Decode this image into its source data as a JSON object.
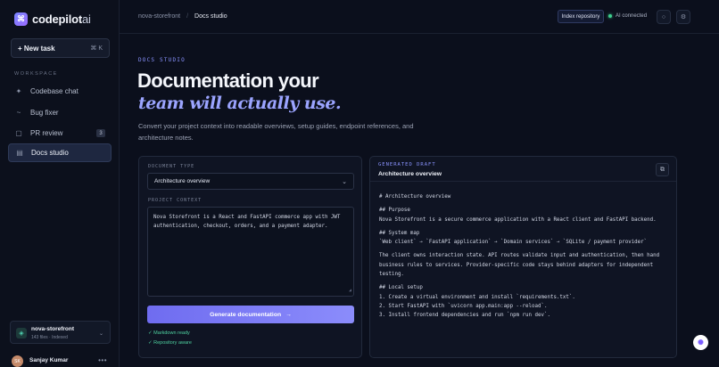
{
  "brand": {
    "name": "codepilot",
    "suffix": "ai",
    "logo_icon": "command-icon"
  },
  "sidebar": {
    "new_task_label": "+ New task",
    "new_task_shortcut": "⌘ K",
    "section": "WORKSPACE",
    "items": [
      {
        "label": "Codebase chat",
        "icon": "sparkle-icon",
        "badge": ""
      },
      {
        "label": "Bug fixer",
        "icon": "wave-icon",
        "badge": ""
      },
      {
        "label": "PR review",
        "icon": "square-icon",
        "badge": "3"
      },
      {
        "label": "Docs studio",
        "icon": "doc-icon",
        "badge": "",
        "active": true
      }
    ],
    "repo": {
      "name": "nova-storefront",
      "meta": "143 files · Indexed"
    },
    "user": {
      "name": "Sanjay Kumar",
      "initials": "SK"
    }
  },
  "topbar": {
    "breadcrumb": [
      "nova-storefront",
      "Docs studio"
    ],
    "index_button": "Index repository",
    "ai_status": "AI connected",
    "status_color": "#3ecf8e"
  },
  "hero": {
    "kicker": "DOCS STUDIO",
    "title_line1": "Documentation your",
    "title_line2": "team will actually use.",
    "description": "Convert your project context into readable overviews, setup guides, endpoint references, and architecture notes."
  },
  "form": {
    "doc_type_label": "DOCUMENT TYPE",
    "doc_type_value": "Architecture overview",
    "context_label": "PROJECT CONTEXT",
    "context_value": "Nova Storefront is a React and FastAPI commerce app with JWT authentication, checkout, orders, and a payment adapter.",
    "generate_label": "Generate documentation",
    "generate_arrow": "→",
    "checks": [
      "✓ Markdown ready",
      "✓ Repository aware"
    ]
  },
  "draft": {
    "kicker": "GENERATED DRAFT",
    "title": "Architecture overview",
    "lines": [
      "# Architecture overview",
      "",
      "## Purpose",
      "Nova Storefront is a secure commerce application with a React client and FastAPI backend.",
      "",
      "## System map",
      "`Web client` → `FastAPI application` → `Domain services` → `SQLite / payment provider`",
      "",
      "The client owns interaction state. API routes validate input and authentication, then hand",
      "business rules to services. Provider-specific code stays behind adapters for independent",
      "testing.",
      "",
      "## Local setup",
      "1. Create a virtual environment and install `requirements.txt`.",
      "2. Start FastAPI with `uvicorn app.main:app --reload`.",
      "3. Install frontend dependencies and run `npm run dev`."
    ]
  },
  "colors": {
    "accent": "#8a93ff",
    "button_gradient_start": "#6f6cf0",
    "button_gradient_end": "#8b8cfb"
  }
}
